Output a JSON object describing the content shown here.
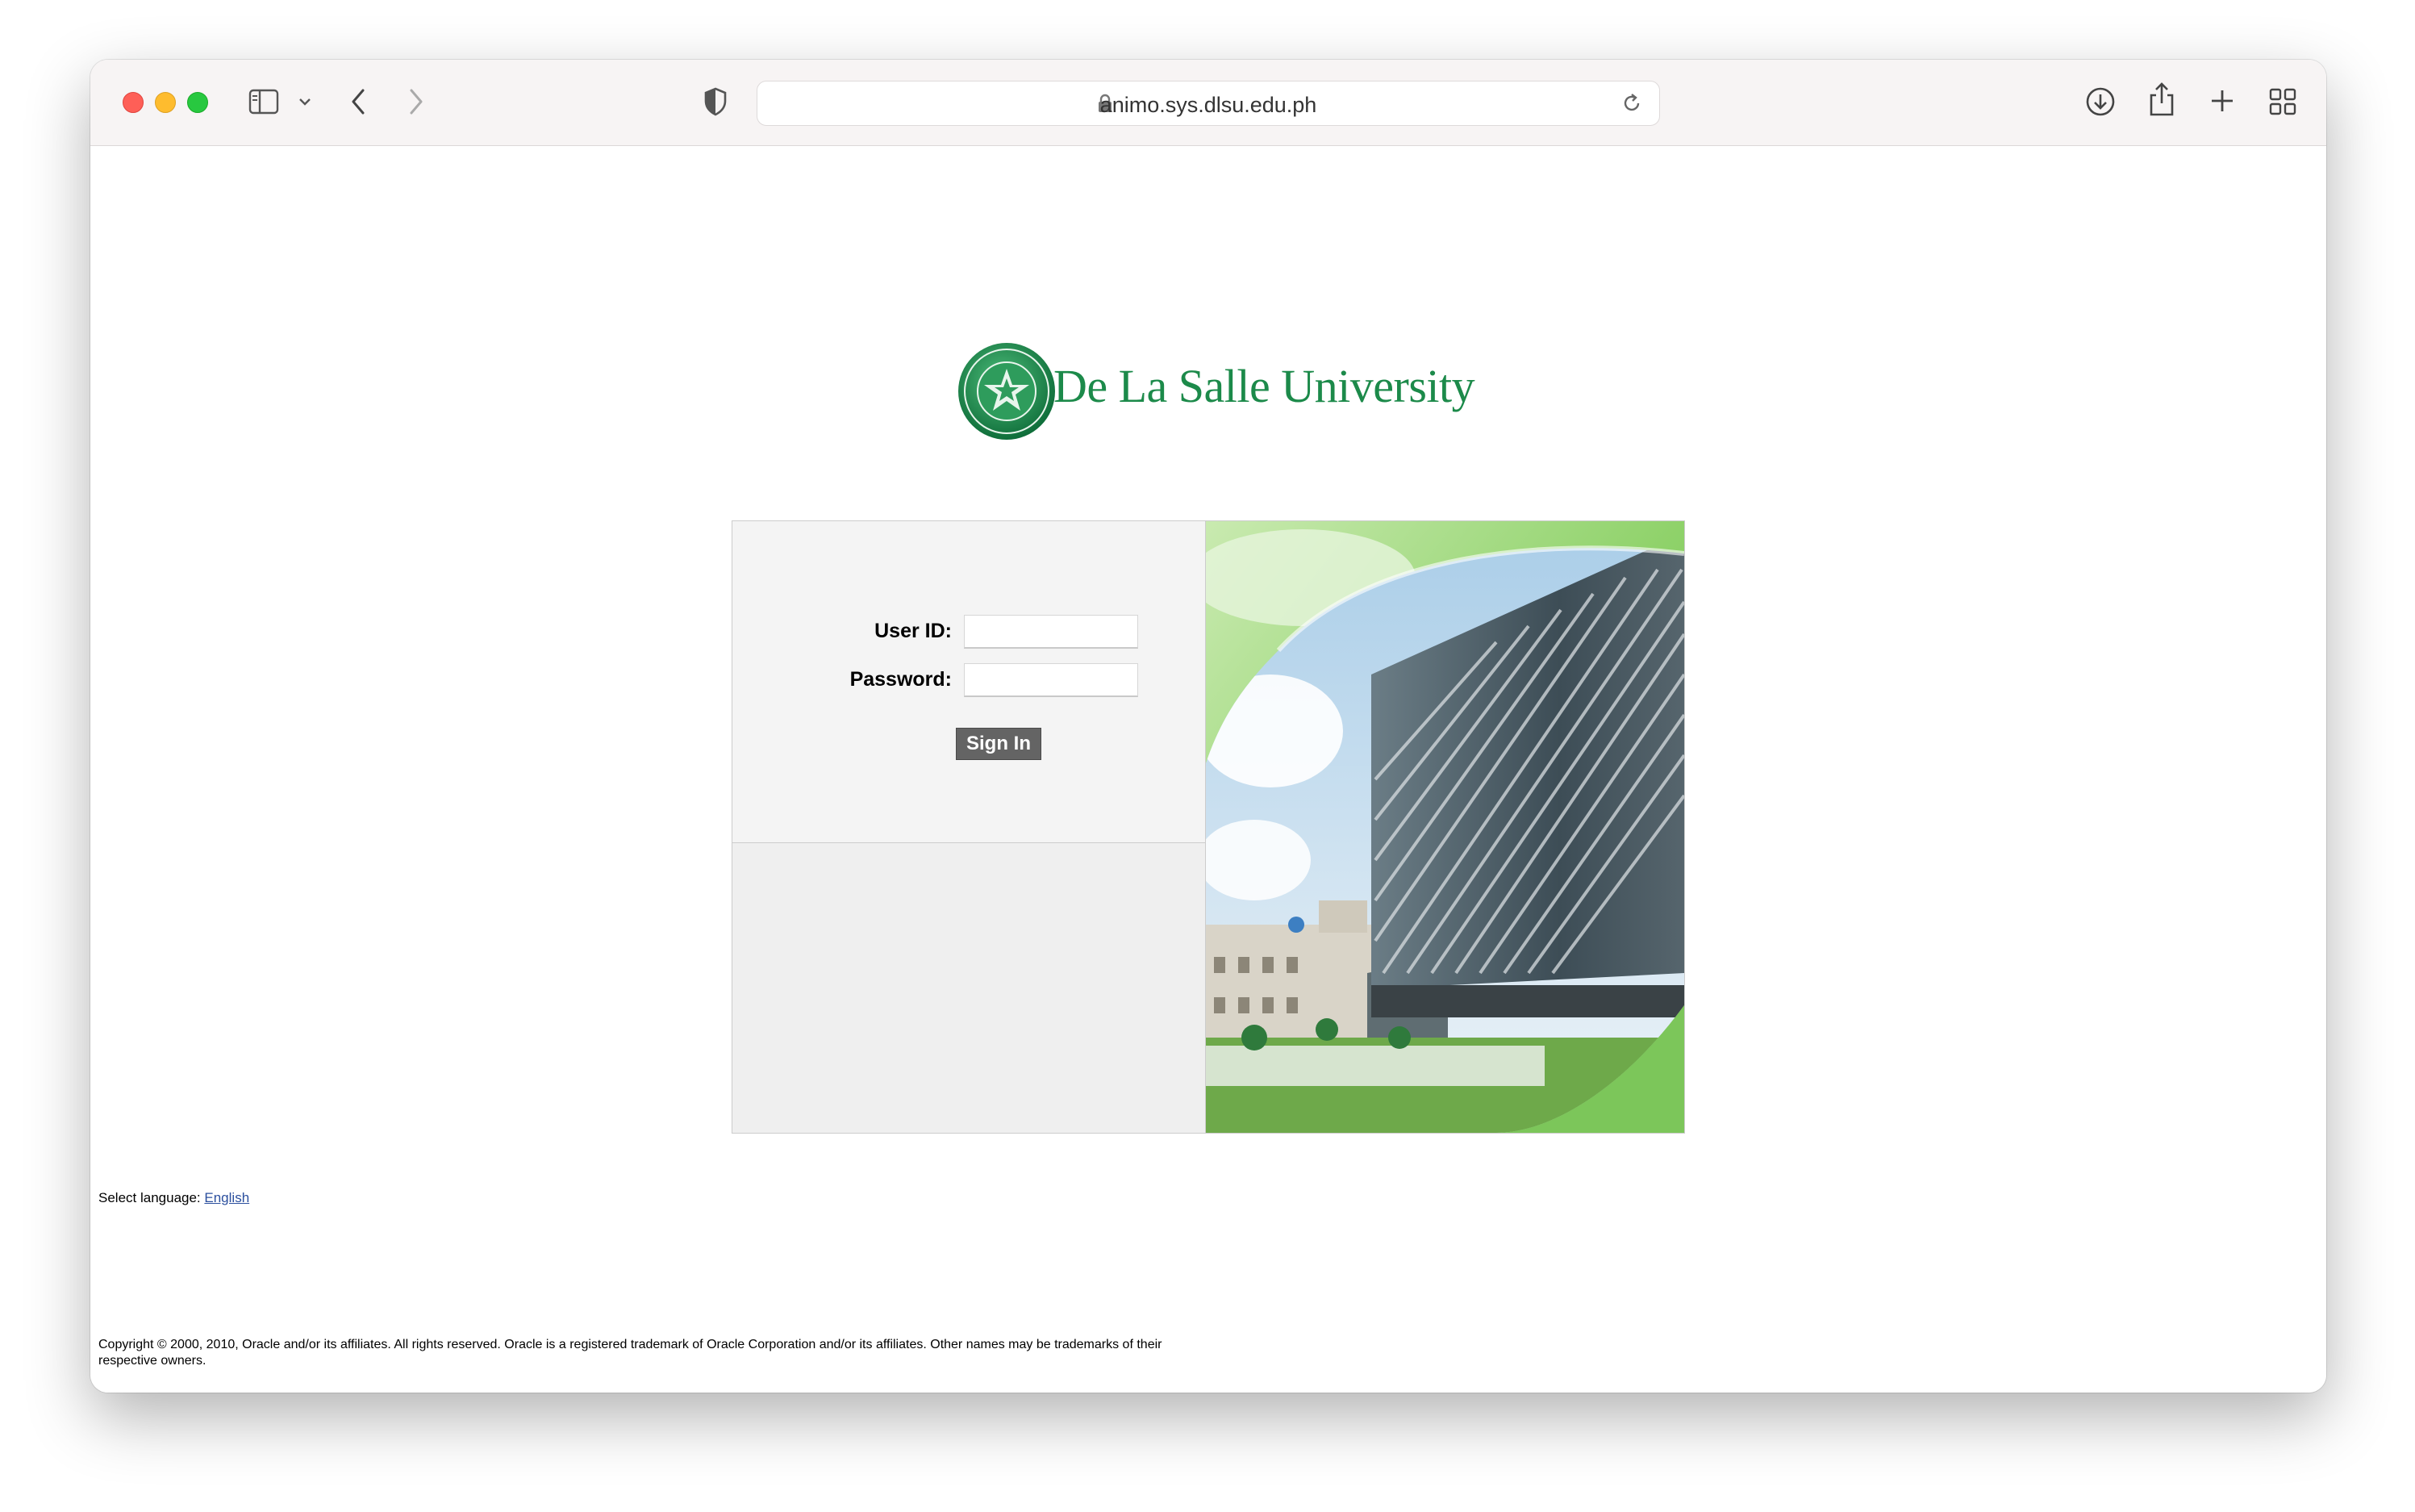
{
  "browser": {
    "url": "animo.sys.dlsu.edu.ph"
  },
  "page": {
    "logo_text": "De La Salle University",
    "login": {
      "user_id_label": "User ID:",
      "password_label": "Password:",
      "user_id_value": "",
      "password_value": "",
      "sign_in_label": "Sign In"
    },
    "language": {
      "prompt": "Select language:",
      "link": "English"
    },
    "copyright": "Copyright © 2000, 2010, Oracle and/or its affiliates. All rights reserved. Oracle is a registered trademark of Oracle Corporation and/or its affiliates. Other names may be trademarks of their respective owners."
  },
  "colors": {
    "brand_green": "#1c8a4a",
    "button_gray": "#646464",
    "link_blue": "#2b4f9e"
  },
  "icons": [
    "sidebar-icon",
    "chevron-down-icon",
    "back-icon",
    "forward-icon",
    "shield-icon",
    "lock-icon",
    "reload-icon",
    "download-icon",
    "share-icon",
    "new-tab-icon",
    "tab-overview-icon"
  ]
}
